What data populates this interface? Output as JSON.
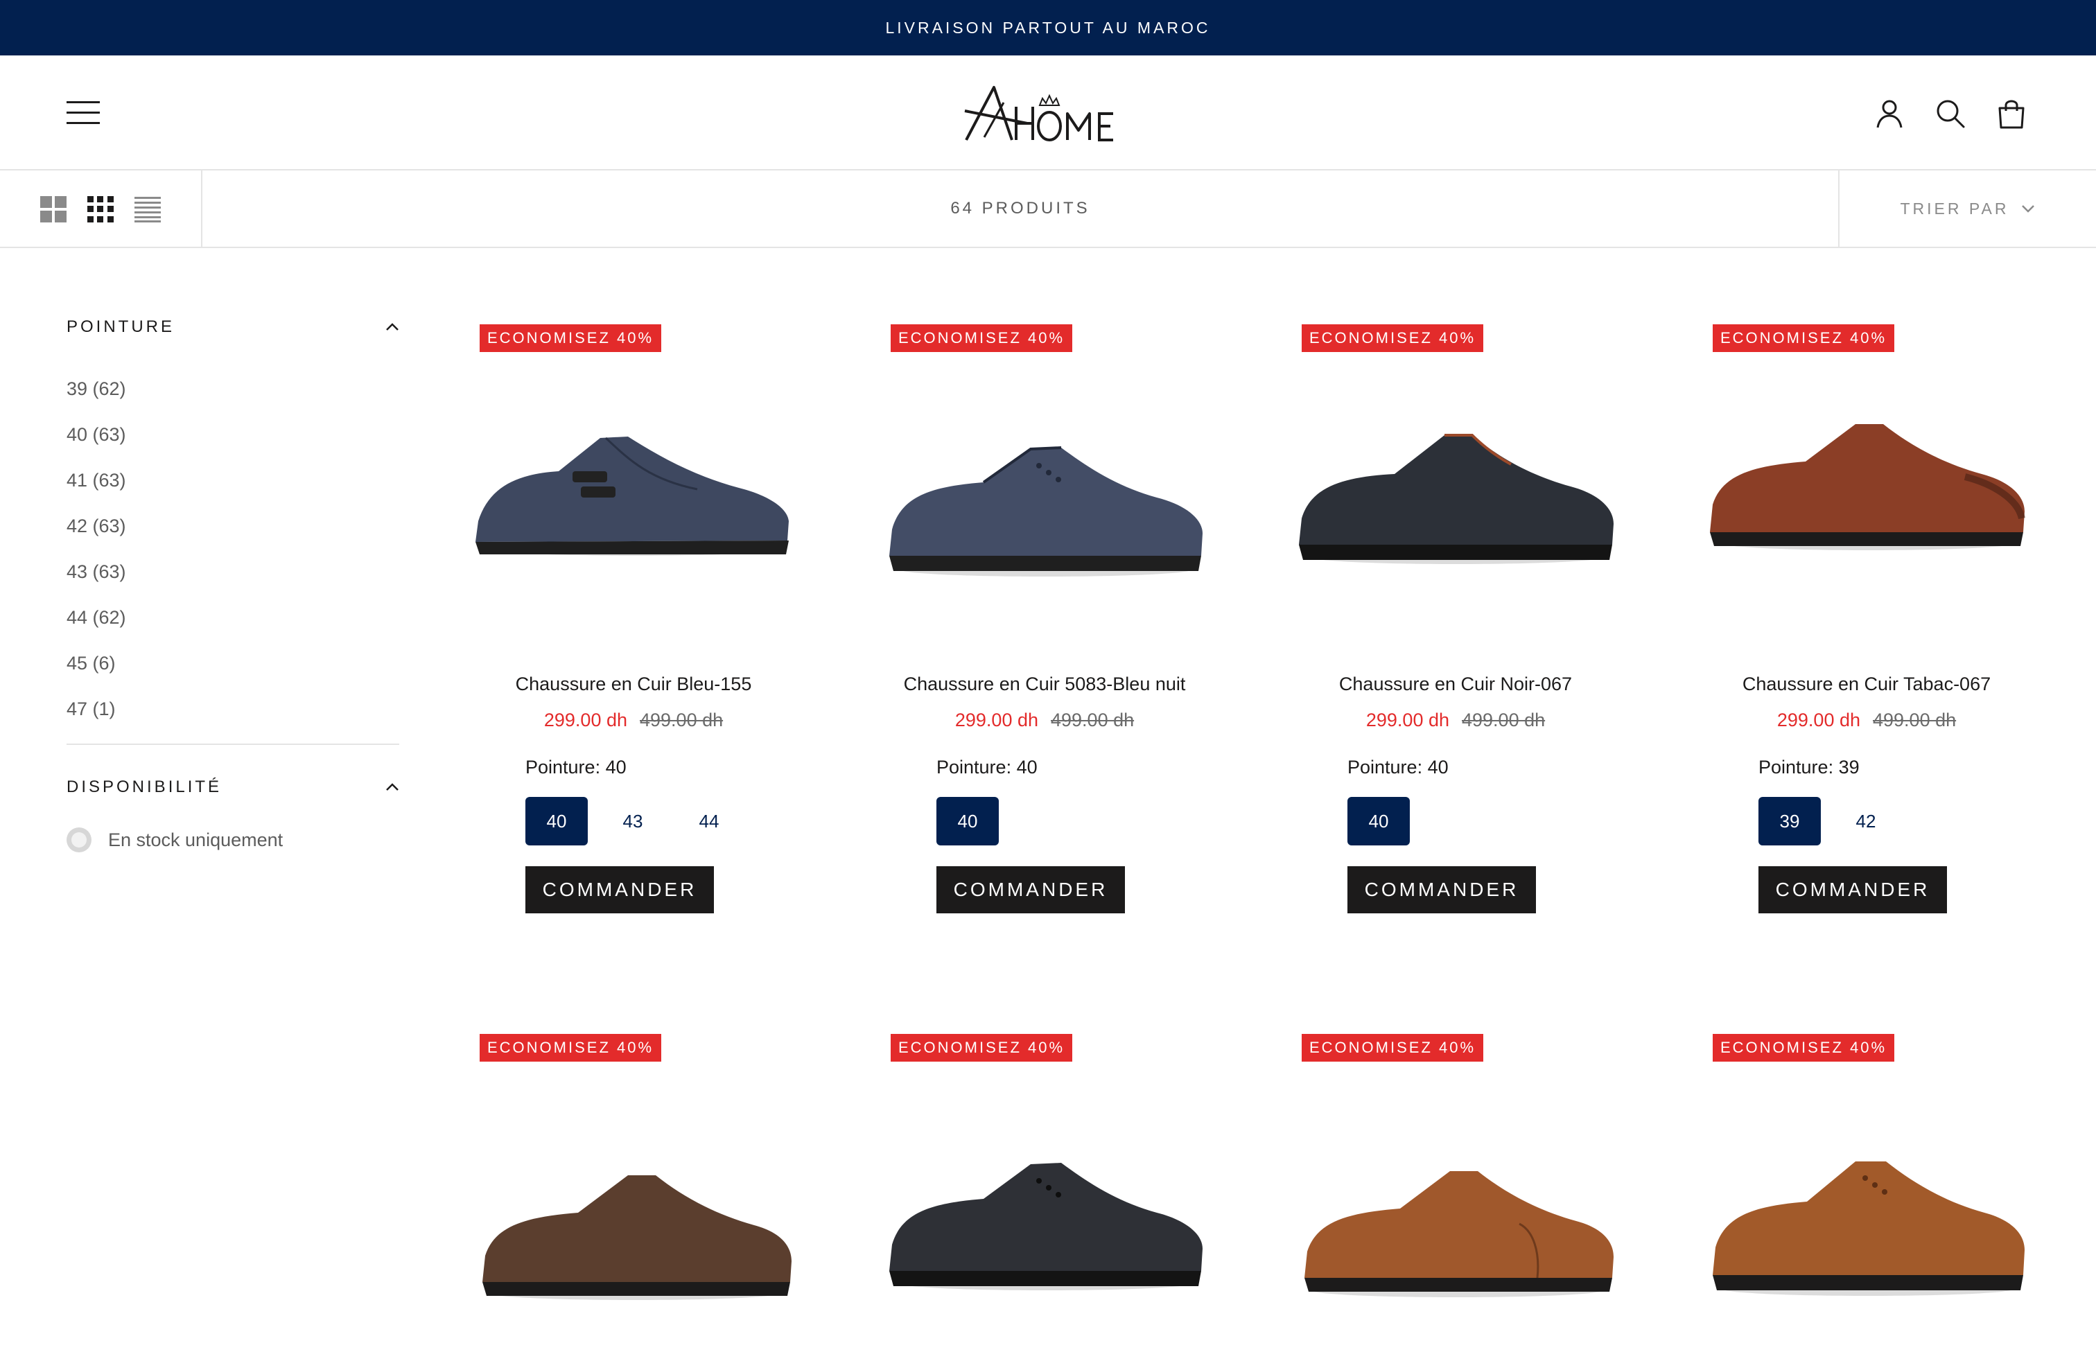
{
  "announcement": "LIVRAISON PARTOUT AU MAROC",
  "brand": {
    "name": "AHOME"
  },
  "header_icons": [
    "menu-icon",
    "account-icon",
    "search-icon",
    "cart-icon"
  ],
  "toolbar": {
    "view_modes": [
      "grid-large-icon",
      "grid-small-icon",
      "list-icon"
    ],
    "product_count": "64 PRODUITS",
    "sort_label": "TRIER PAR"
  },
  "filters": {
    "size": {
      "title": "POINTURE",
      "options": [
        "39 (62)",
        "40 (63)",
        "41 (63)",
        "42 (63)",
        "43 (63)",
        "44 (62)",
        "45 (6)",
        "47 (1)"
      ]
    },
    "availability": {
      "title": "DISPONIBILITÉ",
      "in_stock_label": "En stock uniquement"
    }
  },
  "colors": {
    "navy": "#02204f",
    "sale_red": "#e32b2b",
    "text": "#1c1b1b",
    "muted": "#5c5c5c"
  },
  "products": [
    {
      "badge": "ECONOMISEZ 40%",
      "title": "Chaussure en Cuir Bleu-155",
      "price": "299.00 dh",
      "compare_price": "499.00 dh",
      "size_label": "Pointure: 40",
      "sizes": [
        "40",
        "43",
        "44"
      ],
      "selected_size": "40",
      "cta": "COMMANDER"
    },
    {
      "badge": "ECONOMISEZ 40%",
      "title": "Chaussure en Cuir 5083-Bleu nuit",
      "price": "299.00 dh",
      "compare_price": "499.00 dh",
      "size_label": "Pointure: 40",
      "sizes": [
        "40"
      ],
      "selected_size": "40",
      "cta": "COMMANDER"
    },
    {
      "badge": "ECONOMISEZ 40%",
      "title": "Chaussure en Cuir Noir-067",
      "price": "299.00 dh",
      "compare_price": "499.00 dh",
      "size_label": "Pointure: 40",
      "sizes": [
        "40"
      ],
      "selected_size": "40",
      "cta": "COMMANDER"
    },
    {
      "badge": "ECONOMISEZ 40%",
      "title": "Chaussure en Cuir Tabac-067",
      "price": "299.00 dh",
      "compare_price": "499.00 dh",
      "size_label": "Pointure: 39",
      "sizes": [
        "39",
        "42"
      ],
      "selected_size": "39",
      "cta": "COMMANDER"
    },
    {
      "badge": "ECONOMISEZ 40%"
    },
    {
      "badge": "ECONOMISEZ 40%"
    },
    {
      "badge": "ECONOMISEZ 40%"
    },
    {
      "badge": "ECONOMISEZ 40%"
    }
  ]
}
